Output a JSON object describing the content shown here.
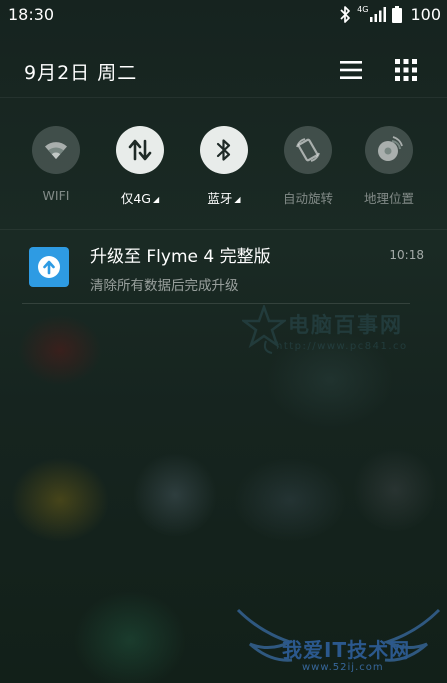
{
  "status_bar": {
    "time": "18:30",
    "network_label": "4G",
    "battery": "100"
  },
  "header": {
    "date": "9月2日  周二"
  },
  "toggles": [
    {
      "label": "WIFI",
      "icon": "wifi-icon",
      "active": false
    },
    {
      "label": "仅4G",
      "icon": "mobile-data-icon",
      "active": true,
      "has_menu": true
    },
    {
      "label": "蓝牙",
      "icon": "bluetooth-icon",
      "active": true,
      "has_menu": true
    },
    {
      "label": "自动旋转",
      "icon": "auto-rotate-icon",
      "active": false
    },
    {
      "label": "地理位置",
      "icon": "location-icon",
      "active": false
    }
  ],
  "notification": {
    "title": "升级至 Flyme 4 完整版",
    "subtitle": "清除所有数据后完成升级",
    "time": "10:18",
    "icon": "upgrade-icon",
    "icon_color": "#2e9be3"
  },
  "watermarks": {
    "pc841_title": "电脑百事网",
    "pc841_url": "http://www.pc841.co",
    "site52_title": "我爱IT技术网",
    "site52_url": "www.52ij.com"
  }
}
